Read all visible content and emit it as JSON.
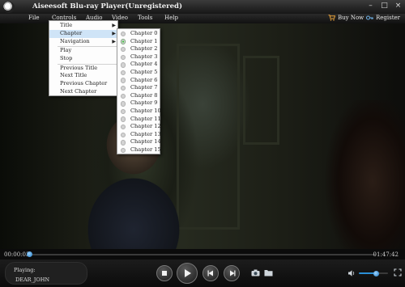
{
  "window": {
    "title": "Aiseesoft Blu-ray Player(Unregistered)",
    "buttons": [
      "minimize",
      "maximize",
      "close"
    ]
  },
  "menubar": {
    "items": [
      "File",
      "Controls",
      "Audio",
      "Video",
      "Tools",
      "Help"
    ],
    "buy_now": "Buy Now",
    "register": "Register"
  },
  "controls_menu": {
    "items": [
      {
        "label": "Title",
        "submenu": true
      },
      {
        "label": "Chapter",
        "submenu": true,
        "highlighted": true
      },
      {
        "label": "Navigation",
        "submenu": true
      },
      {
        "label": "Play"
      },
      {
        "label": "Stop"
      },
      {
        "label": "Previous Title"
      },
      {
        "label": "Next Title"
      },
      {
        "label": "Previous Chapter"
      },
      {
        "label": "Next Chapter"
      }
    ],
    "arrow": "▶"
  },
  "chapter_menu": {
    "selected": "Chapter 1",
    "items": [
      "Chapter 0",
      "Chapter 1",
      "Chapter 2",
      "Chapter 3",
      "Chapter 4",
      "Chapter 5",
      "Chapter 6",
      "Chapter 7",
      "Chapter 8",
      "Chapter 9",
      "Chapter 10",
      "Chapter 11",
      "Chapter 12",
      "Chapter 13",
      "Chapter 14",
      "Chapter 15"
    ]
  },
  "playback": {
    "elapsed": "00:00:03",
    "duration": "01:47:42",
    "progress_fraction": 0.0005,
    "status_label": "Playing:",
    "disc_name": "DEAR_JOHN",
    "volume_fraction": 0.6
  },
  "colors": {
    "accent": "#2b8fd6",
    "menu_highlight": "#cfe4f7",
    "selected_radio": "#3fbf3f"
  },
  "icons": [
    "app-logo-icon",
    "minimize-icon",
    "maximize-icon",
    "close-icon",
    "cart-icon",
    "key-icon",
    "stop-icon",
    "play-icon",
    "previous-chapter-icon",
    "next-chapter-icon",
    "snapshot-icon",
    "folder-icon",
    "volume-icon",
    "fullscreen-icon"
  ]
}
